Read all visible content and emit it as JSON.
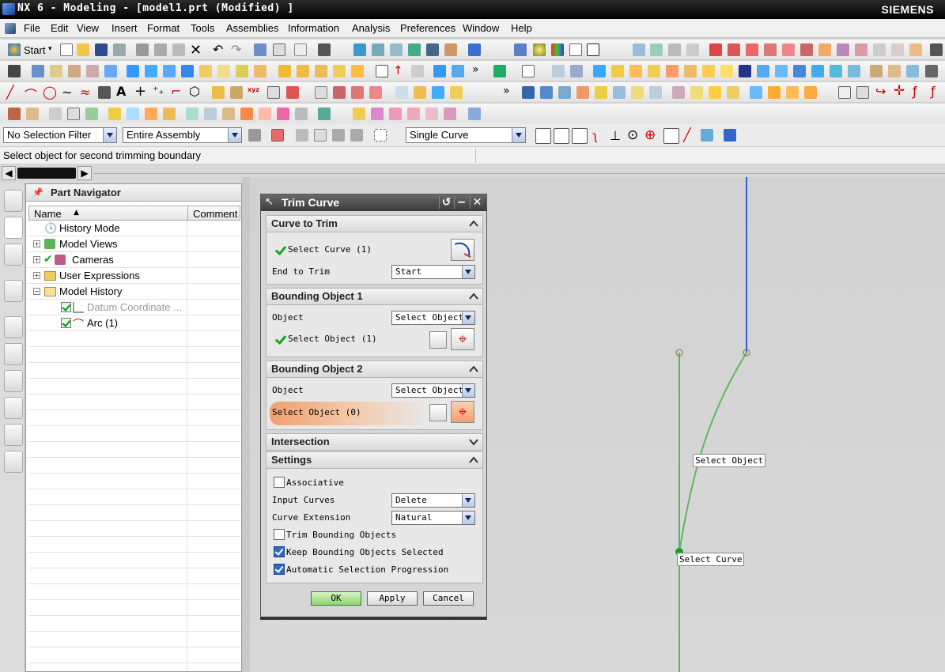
{
  "window": {
    "title": "NX 6 - Modeling - [model1.prt (Modified) ]",
    "brand": "SIEMENS"
  },
  "menu": [
    "File",
    "Edit",
    "View",
    "Insert",
    "Format",
    "Tools",
    "Assemblies",
    "Information",
    "Analysis",
    "Preferences",
    "Window",
    "Help"
  ],
  "toolbar": {
    "start_label": "Start"
  },
  "filters": {
    "selection_filter": "No Selection Filter",
    "scope": "Entire Assembly",
    "curve_rule": "Single Curve"
  },
  "status": {
    "prompt": "Select object for second trimming boundary"
  },
  "navigator": {
    "title": "Part Navigator",
    "columns": {
      "name": "Name",
      "comment": "Comment"
    },
    "items": [
      {
        "label": "History Mode"
      },
      {
        "label": "Model Views"
      },
      {
        "label": "Cameras"
      },
      {
        "label": "User Expressions"
      },
      {
        "label": "Model History"
      },
      {
        "label": "Datum Coordinate ..."
      },
      {
        "label": "Arc (1)"
      }
    ]
  },
  "dialog": {
    "title": "Trim Curve",
    "sections": {
      "curve_to_trim": {
        "title": "Curve to Trim",
        "select_curve": "Select Curve (1)",
        "end_label": "End to Trim",
        "end_value": "Start"
      },
      "bounding1": {
        "title": "Bounding Object 1",
        "object_label": "Object",
        "object_value": "Select Object",
        "select": "Select Object (1)"
      },
      "bounding2": {
        "title": "Bounding Object 2",
        "object_label": "Object",
        "object_value": "Select Object",
        "select": "Select Object (0)"
      },
      "intersection": {
        "title": "Intersection"
      },
      "settings": {
        "title": "Settings",
        "associative": "Associative",
        "input_curves_label": "Input Curves",
        "input_curves_value": "Delete",
        "curve_ext_label": "Curve Extension",
        "curve_ext_value": "Natural",
        "trim_bounding": "Trim Bounding Objects",
        "keep_selected": "Keep Bounding Objects Selected",
        "auto_progression": "Automatic Selection Progression"
      }
    },
    "buttons": {
      "ok": "OK",
      "apply": "Apply",
      "cancel": "Cancel"
    }
  },
  "viewport": {
    "tag_object": "Select Object",
    "tag_curve": "Select Curve"
  },
  "colors": {
    "accent_green": "#1aa01a",
    "line_green": "#5cb85c",
    "line_blue": "#3060d0",
    "highlight_orange": "#f2a878"
  }
}
